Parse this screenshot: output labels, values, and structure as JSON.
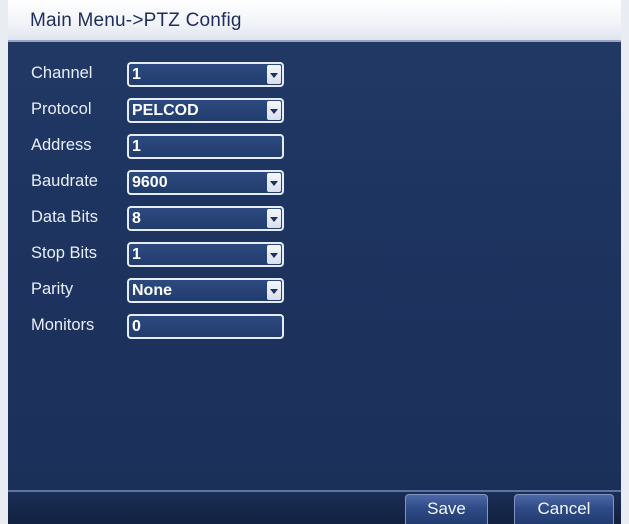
{
  "window": {
    "title": "Main Menu->PTZ Config"
  },
  "form": {
    "rows": [
      {
        "label": "Channel",
        "value": "1",
        "type": "select"
      },
      {
        "label": "Protocol",
        "value": "PELCOD",
        "type": "select"
      },
      {
        "label": "Address",
        "value": "1",
        "type": "input"
      },
      {
        "label": "Baudrate",
        "value": "9600",
        "type": "select"
      },
      {
        "label": "Data Bits",
        "value": "8",
        "type": "select"
      },
      {
        "label": "Stop Bits",
        "value": "1",
        "type": "select"
      },
      {
        "label": "Parity",
        "value": "None",
        "type": "select"
      },
      {
        "label": "Monitors",
        "value": "0",
        "type": "input"
      }
    ]
  },
  "buttons": {
    "save_label": "Save",
    "cancel_label": "Cancel"
  },
  "colors": {
    "background": "#1e3460",
    "field_border": "#e6ecf5",
    "title_text": "#1e2d5c"
  }
}
